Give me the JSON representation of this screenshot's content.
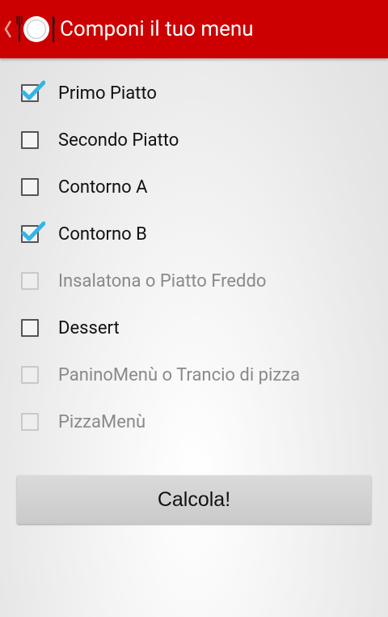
{
  "actionbar": {
    "title": "Componi il tuo menu",
    "background_color": "#cc0000",
    "up_icon": "chevron-left-icon",
    "app_icon": "plate-fork-knife-icon"
  },
  "options": [
    {
      "key": "primo",
      "label": "Primo Piatto",
      "checked": true,
      "enabled": true
    },
    {
      "key": "secondo",
      "label": "Secondo Piatto",
      "checked": false,
      "enabled": true
    },
    {
      "key": "contorno-a",
      "label": "Contorno A",
      "checked": false,
      "enabled": true
    },
    {
      "key": "contorno-b",
      "label": "Contorno B",
      "checked": true,
      "enabled": true
    },
    {
      "key": "insalatona",
      "label": "Insalatona o Piatto Freddo",
      "checked": false,
      "enabled": false
    },
    {
      "key": "dessert",
      "label": "Dessert",
      "checked": false,
      "enabled": true
    },
    {
      "key": "panino",
      "label": "PaninoMenù o Trancio di pizza",
      "checked": false,
      "enabled": false
    },
    {
      "key": "pizza",
      "label": "PizzaMenù",
      "checked": false,
      "enabled": false
    }
  ],
  "calculate_button": {
    "label": "Calcola!"
  },
  "colors": {
    "accent_check": "#33b5e5",
    "text": "#111111",
    "disabled_text": "#8a8a8a"
  }
}
